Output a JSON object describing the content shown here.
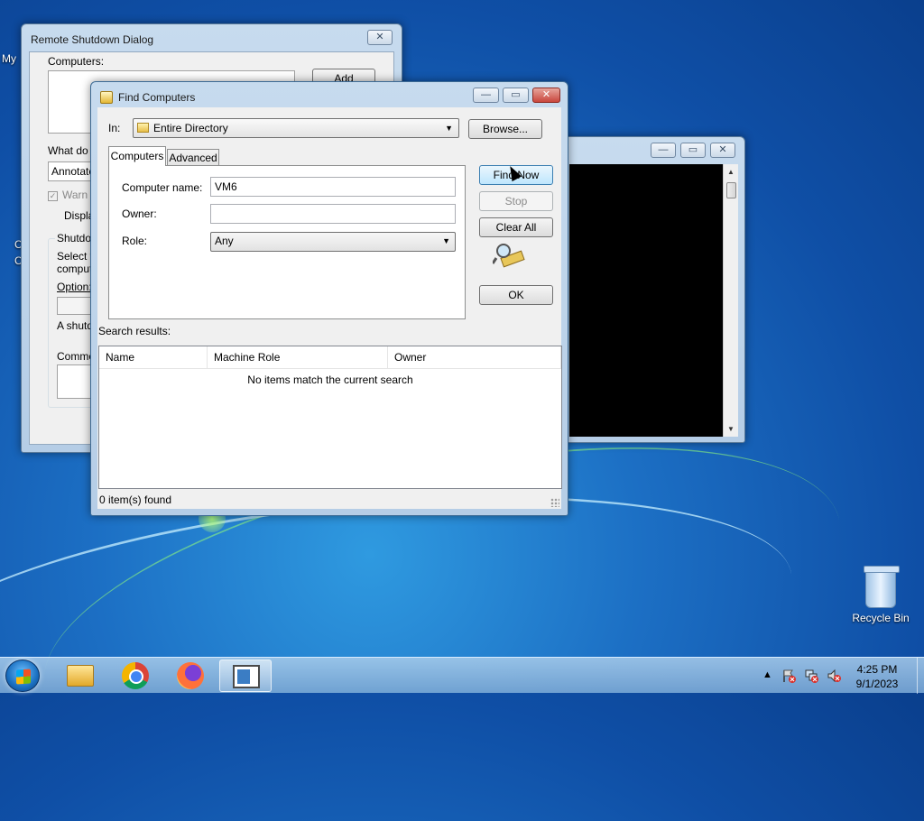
{
  "desktop": {
    "icons": [
      {
        "label": "Recycle Bin"
      }
    ],
    "edge_labels": [
      "My",
      "C",
      "C"
    ]
  },
  "remote_shutdown": {
    "title": "Remote Shutdown Dialog",
    "close_glyph": "✕",
    "computers_label": "Computers:",
    "add_button": "Add",
    "what_label": "What do y",
    "what_value": "Annotate",
    "warn_label": "Warn",
    "display_label": "Displa",
    "shutdown_group": "Shutdov",
    "select_text_1": "Select th",
    "select_text_2": "compute",
    "option_label": "Option:",
    "shutdown_text": "A shutdo",
    "comment_label": "Commer"
  },
  "console_window": {
    "minimize_glyph": "—",
    "maximize_glyph": "▭",
    "close_glyph": "✕"
  },
  "find_computers": {
    "title": "Find Computers",
    "in_label": "In:",
    "in_value": "Entire Directory",
    "browse_button": "Browse...",
    "tabs": [
      {
        "label": "Computers",
        "active": true
      },
      {
        "label": "Advanced",
        "active": false
      }
    ],
    "computer_name_label": "Computer name:",
    "computer_name_value": "VM6",
    "owner_label": "Owner:",
    "owner_value": "",
    "role_label": "Role:",
    "role_value": "Any",
    "find_now_button": "Find Now",
    "stop_button": "Stop",
    "clear_all_button": "Clear All",
    "ok_button": "OK",
    "search_results_label": "Search results:",
    "columns": [
      "Name",
      "Machine Role",
      "Owner"
    ],
    "empty_message": "No items match the current search",
    "status": "0 item(s) found",
    "minimize_glyph": "—",
    "maximize_glyph": "▭",
    "close_glyph": "✕"
  },
  "taskbar": {
    "apps": [
      "explorer",
      "chrome",
      "firefox",
      "remote-shutdown"
    ],
    "active_app": "remote-shutdown",
    "tray_chevron": "▲",
    "clock_time": "4:25 PM",
    "clock_date": "9/1/2023"
  },
  "colors": {
    "title_close": "#c9463d",
    "accent": "#3c7fb1"
  }
}
